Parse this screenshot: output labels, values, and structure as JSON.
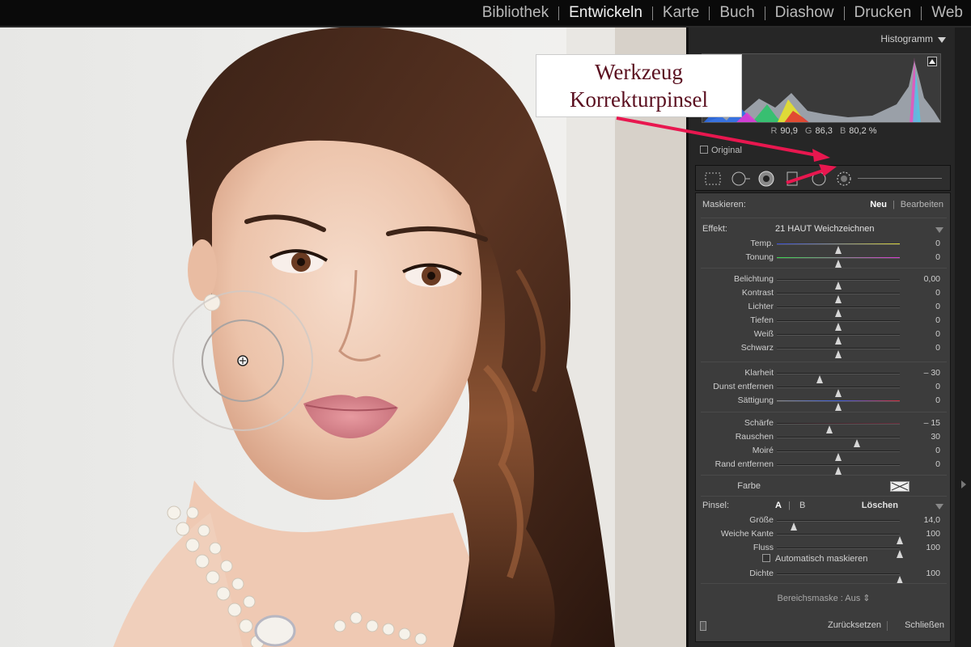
{
  "modules": [
    {
      "label": "Bibliothek",
      "active": false
    },
    {
      "label": "Entwickeln",
      "active": true
    },
    {
      "label": "Karte",
      "active": false
    },
    {
      "label": "Buch",
      "active": false
    },
    {
      "label": "Diashow",
      "active": false
    },
    {
      "label": "Drucken",
      "active": false
    },
    {
      "label": "Web",
      "active": false
    }
  ],
  "histogram": {
    "title": "Histogramm",
    "r_label": "R",
    "r_value": "90,9",
    "g_label": "G",
    "g_value": "86,3",
    "b_label": "B",
    "b_value": "80,2",
    "unit": "%",
    "original_label": "Original"
  },
  "annotation": {
    "line1": "Werkzeug",
    "line2": "Korrekturpinsel"
  },
  "mask": {
    "label": "Maskieren:",
    "new_label": "Neu",
    "edit_label": "Bearbeiten"
  },
  "effect": {
    "label": "Effekt:",
    "value": "21 HAUT Weichzeichnen"
  },
  "sliders_group1": [
    {
      "label": "Temp.",
      "value": "0",
      "level": 0.5
    },
    {
      "label": "Tonung",
      "value": "0",
      "level": 0.5
    }
  ],
  "sliders_group2": [
    {
      "label": "Belichtung",
      "value": "0,00",
      "level": 0.5
    },
    {
      "label": "Kontrast",
      "value": "0",
      "level": 0.5
    },
    {
      "label": "Lichter",
      "value": "0",
      "level": 0.5
    },
    {
      "label": "Tiefen",
      "value": "0",
      "level": 0.5
    },
    {
      "label": "Weiß",
      "value": "0",
      "level": 0.5
    },
    {
      "label": "Schwarz",
      "value": "0",
      "level": 0.5
    }
  ],
  "sliders_group3": [
    {
      "label": "Klarheit",
      "value": "– 30",
      "level": 0.35
    },
    {
      "label": "Dunst entfernen",
      "value": "0",
      "level": 0.5
    },
    {
      "label": "Sättigung",
      "value": "0",
      "level": 0.5
    }
  ],
  "sliders_group4": [
    {
      "label": "Schärfe",
      "value": "– 15",
      "level": 0.43
    },
    {
      "label": "Rauschen",
      "value": "30",
      "level": 0.65
    },
    {
      "label": "Moiré",
      "value": "0",
      "level": 0.5
    },
    {
      "label": "Rand entfernen",
      "value": "0",
      "level": 0.5
    }
  ],
  "color": {
    "label": "Farbe"
  },
  "brush": {
    "label": "Pinsel:",
    "a_label": "A",
    "b_label": "B",
    "delete_label": "Löschen",
    "sliders": [
      {
        "label": "Größe",
        "value": "14,0",
        "level": 0.14
      },
      {
        "label": "Weiche Kante",
        "value": "100",
        "level": 1.0
      },
      {
        "label": "Fluss",
        "value": "100",
        "level": 1.0
      }
    ],
    "automask_label": "Automatisch maskieren",
    "density": {
      "label": "Dichte",
      "value": "100",
      "level": 1.0
    }
  },
  "range_mask": "Bereichsmaske : Aus",
  "footer": {
    "reset_label": "Zurücksetzen",
    "close_label": "Schließen"
  },
  "colors": {
    "accent_arrow": "#e8174f",
    "callout_text": "#5a0f1f"
  }
}
